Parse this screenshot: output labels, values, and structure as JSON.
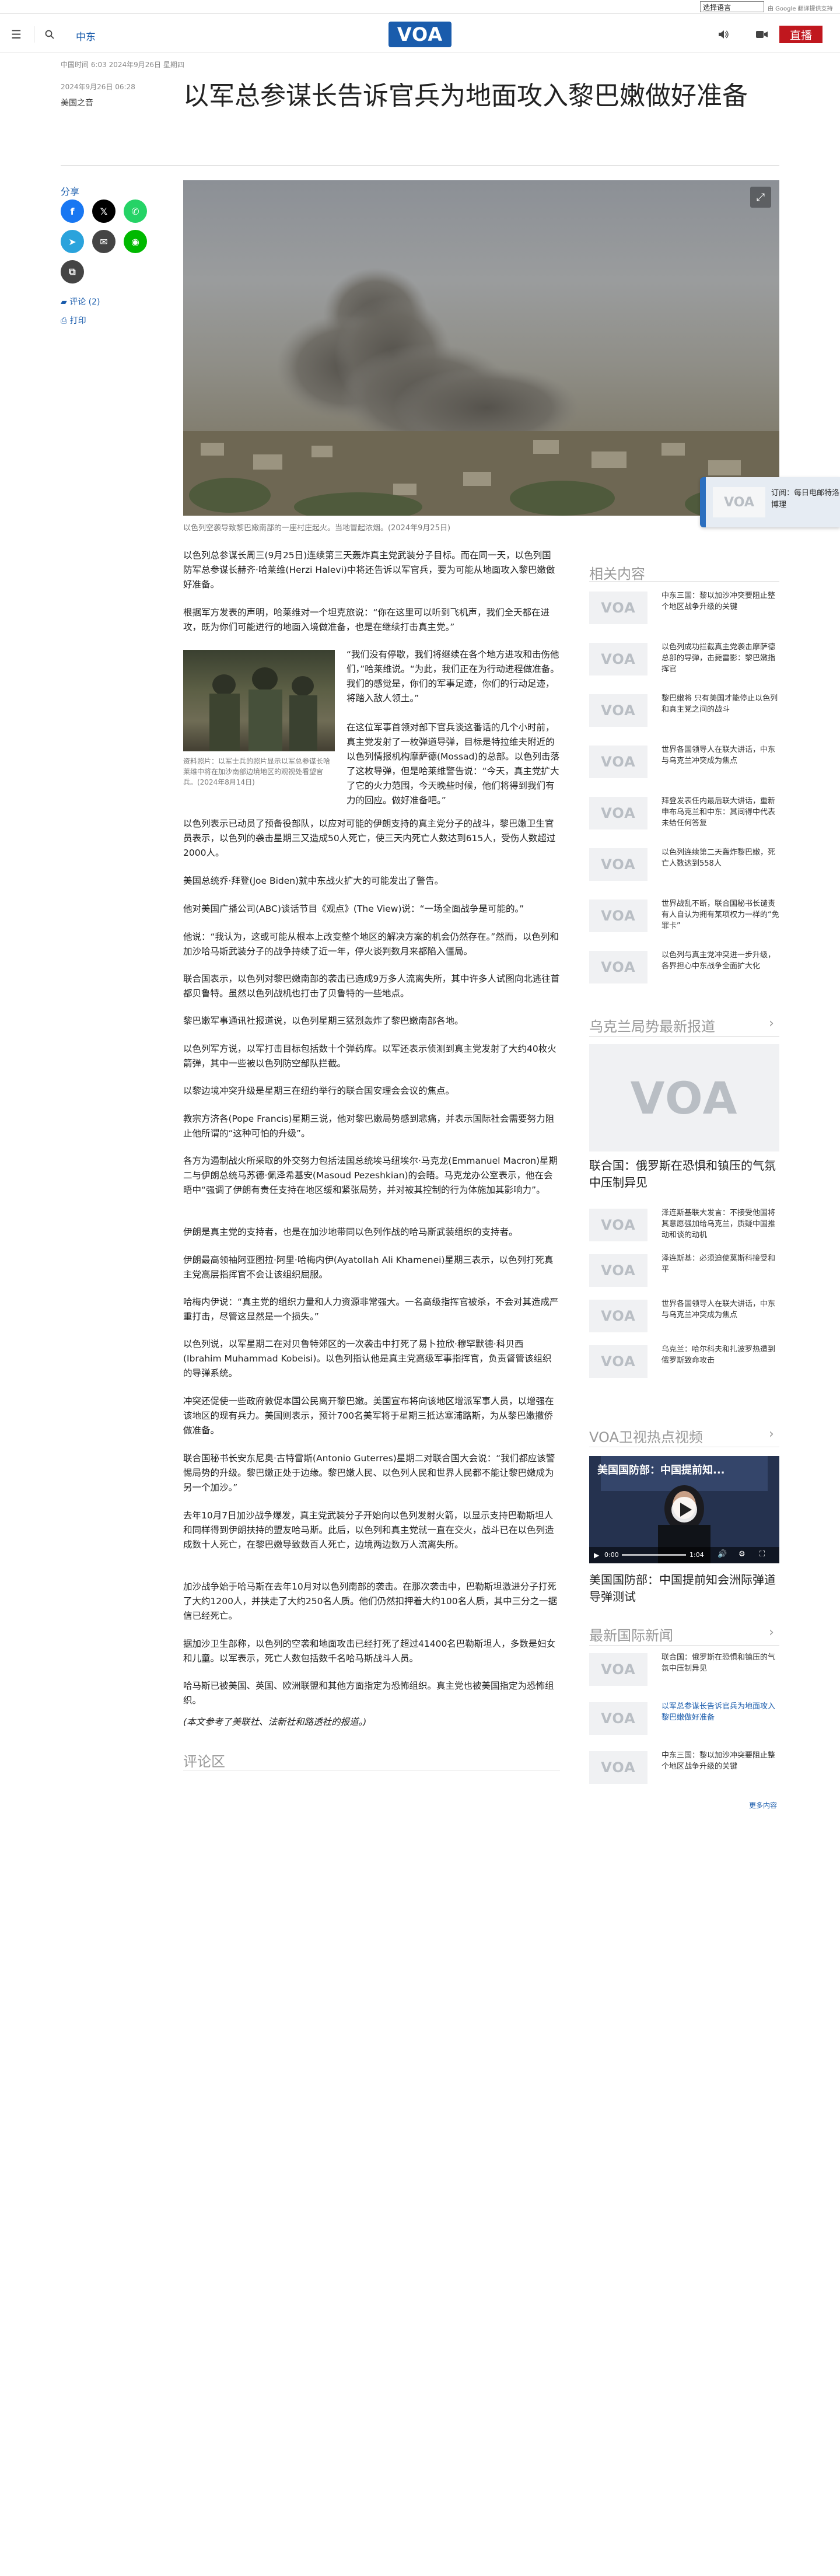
{
  "translate": {
    "select_label": "选择语言",
    "powered_by": "由 Google 翻译提供支持"
  },
  "header": {
    "region": "中东",
    "logo": "VOA",
    "live": "直播"
  },
  "meta": {
    "dateline": "中国时间 6:03 2024年9月26日 星期四",
    "pubdate": "2024年9月26日 06:28",
    "author": "美国之音"
  },
  "article": {
    "title": "以军总参谋长告诉官兵为地面攻入黎巴嫩做好准备",
    "hero_caption": "以色列空袭导致黎巴嫩南部的一座村庄起火。当地冒起浓烟。(2024年9月25日)",
    "paragraphs": [
      "以色列总参谋长周三(9月25日)连续第三天轰炸真主党武装分子目标。而在同一天，以色列国防军总参谋长赫齐·哈莱维(Herzi Halevi)中将还告诉以军官兵，要为可能从地面攻入黎巴嫩做好准备。",
      "根据军方发表的声明，哈莱维对一个坦克旅说：“你在这里可以听到飞机声，我们全天都在进攻，既为你们可能进行的地面入境做准备，也是在继续打击真主党。”",
      "以色列表示已动员了预备役部队，以应对可能的伊朗支持的真主党分子的战斗，黎巴嫩卫生官员表示，以色列的袭击星期三又造成50人死亡，使三天内死亡人数达到615人，受伤人数超过2000人。",
      "美国总统乔·拜登(Joe Biden)就中东战火扩大的可能发出了警告。",
      "他对美国广播公司(ABC)谈话节目《观点》(The View)说：“一场全面战争是可能的。”",
      "他说：“我认为，这或可能从根本上改变整个地区的解决方案的机会仍然存在。”然而，以色列和加沙哈马斯武装分子的战争持续了近一年，停火谈判数月来都陷入僵局。",
      "联合国表示，以色列对黎巴嫩南部的袭击已造成9万多人流离失所，其中许多人试图向北逃往首都贝鲁特。虽然以色列战机也打击了贝鲁特的一些地点。",
      "黎巴嫩军事通讯社报道说，以色列星期三猛烈轰炸了黎巴嫩南部各地。",
      "以色列军方说，以军打击目标包括数十个弹药库。以军还表示侦测到真主党发射了大约40枚火箭弹，其中一些被以色列防空部队拦截。",
      "以黎边境冲突升级是星期三在纽约举行的联合国安理会会议的焦点。",
      "教宗方济各(Pope Francis)星期三说，他对黎巴嫩局势感到悲痛，并表示国际社会需要努力阻止他所谓的“这种可怕的升级”。",
      "各方为遏制战火所采取的外交努力包括法国总统埃马纽埃尔·马克龙(Emmanuel Macron)星期二与伊朗总统马苏德·佩泽希基安(Masoud Pezeshkian)的会晤。马克龙办公室表示，他在会晤中“强调了伊朗有责任支持在地区缓和紧张局势，并对被其控制的行为体施加其影响力”。",
      "伊朗是真主党的支持者，也是在加沙地带同以色列作战的哈马斯武装组织的支持者。",
      "伊朗最高领袖阿亚图拉·阿里·哈梅内伊(Ayatollah Ali Khamenei)星期三表示，以色列打死真主党高层指挥官不会让该组织屈服。",
      "哈梅内伊说：“真主党的组织力量和人力资源非常强大。一名高级指挥官被杀，不会对其造成严重打击，尽管这显然是一个损失。”",
      "以色列说，以军星期二在对贝鲁特郊区的一次袭击中打死了易卜拉欣·穆罕默德·科贝西(Ibrahim Muhammad Kobeisi)。以色列指认他是真主党高级军事指挥官，负责督管该组织的导弹系统。",
      "冲突还促使一些政府敦促本国公民离开黎巴嫩。美国宣布将向该地区增派军事人员，以增强在该地区的现有兵力。美国则表示，预计700名美军将于星期三抵达塞浦路斯，为从黎巴嫩撤侨做准备。",
      "联合国秘书长安东尼奥·古特雷斯(Antonio Guterres)星期二对联合国大会说：“我们都应该警惕局势的升级。黎巴嫩正处于边缘。黎巴嫩人民、以色列人民和世界人民都不能让黎巴嫩成为另一个加沙。”",
      "去年10月7日加沙战争爆发，真主党武装分子开始向以色列发射火箭，以显示支持巴勒斯坦人和同样得到伊朗扶持的盟友哈马斯。此后，以色列和真主党就一直在交火，战斗已在以色列造成数十人死亡，在黎巴嫩导致数百人死亡，边境两边数万人流离失所。",
      "加沙战争始于哈马斯在去年10月对以色列南部的袭击。在那次袭击中，巴勒斯坦激进分子打死了大约1200人，并挟走了大约250名人质。他们仍然扣押着大约100名人质，其中三分之一据信已经死亡。",
      "据加沙卫生部称，以色列的空袭和地面攻击已经打死了超过41400名巴勒斯坦人，多数是妇女和儿童。以军表示，死亡人数包括数千名哈马斯战斗人员。",
      "哈马斯已被美国、英国、欧洲联盟和其他方面指定为恐怖组织。真主党也被美国指定为恐怖组织。",
      "(本文参考了美联社、法新社和路透社的报道。)"
    ],
    "inline_quote": "“我们没有停歇，我们将继续在各个地方进攻和击伤他们，”哈莱维说。“为此，我们正在为行动进程做准备。我们的感觉是，你们的军事足迹，你们的行动足迹，将踏入敌人领土。”\n\n在这位军事首领对部下官兵谈这番话的几个小时前，真主党发射了一枚弹道导弹，目标是特拉维夫附近的以色列情报机构摩萨德(Mossad)的总部。以色列击落了这枚导弹，但是哈莱维警告说：“今天，真主党扩大了它的火力范围，今天晚些时候，他们将得到我们有力的回应。做好准备吧。”",
    "inline_caption": "资料照片：以军士兵的照片显示以军总参谋长哈莱维中将在加沙南部边境地区的观视处看望官兵。(2024年8月14日)",
    "comments_title": "评论区"
  },
  "share": {
    "label": "分享",
    "comments": "评论 (2)",
    "print": "打印"
  },
  "sidebar": {
    "related_title": "相关内容",
    "related": [
      "中东三国：黎以加沙冲突要阻止整个地区战争升级的关键",
      "以色列成功拦截真主党袭击摩萨德总部的导弹，击毙雷影：黎巴嫩指挥官",
      "黎巴嫩将 只有美国才能停止以色列和真主党之间的战斗",
      "世界各国领导人在联大讲话，中东与乌克兰冲突成为焦点",
      "拜登发表任内最后联大讲话，重新申布乌克兰和中东：其间得中代表未给任何答复",
      "以色列连续第二天轰炸黎巴嫩，死亡人数达到558人",
      "世界战乱不断，联合国秘书长谴责有人自认为拥有某项权力一样的“免罪卡”",
      "以色列与真主党冲突进一步升级，各界担心中东战争全面扩大化"
    ],
    "ukraine_title": "乌克兰局势最新报道",
    "ukraine_big_title": "联合国：俄罗斯在恐惧和镇压的气氛中压制异见",
    "ukraine": [
      "泽连斯基联大发言：不接受他国将其意愿强加给乌克兰，质疑中国推动和谈的动机",
      "泽连斯基：必须迫使莫斯科接受和平",
      "世界各国领导人在联大讲话，中东与乌克兰冲突成为焦点",
      "乌克兰：哈尔科夫和扎波罗热遭到俄罗斯致命攻击"
    ],
    "video_title_section": "VOA卫视热点视频",
    "video_overlay": "美国国防部：中国提前知...",
    "video_time": "1:04",
    "video_current": "0:00",
    "video_title": "美国国防部：中国提前知会洲际弹道导弹测试",
    "intl_title": "最新国际新闻",
    "intl": [
      "联合国：俄罗斯在恐惧和镇压的气氛中压制异见",
      "以军总参谋长告诉官兵为地面攻入黎巴嫩做好准备",
      "中东三国：黎以加沙冲突要阻止整个地区战争升级的关键"
    ],
    "more": "更多内容"
  },
  "popup": {
    "text": "订阅：每日电邮特洛博理"
  },
  "colors": {
    "brand": "#1a5cac",
    "live": "#c0171e"
  }
}
